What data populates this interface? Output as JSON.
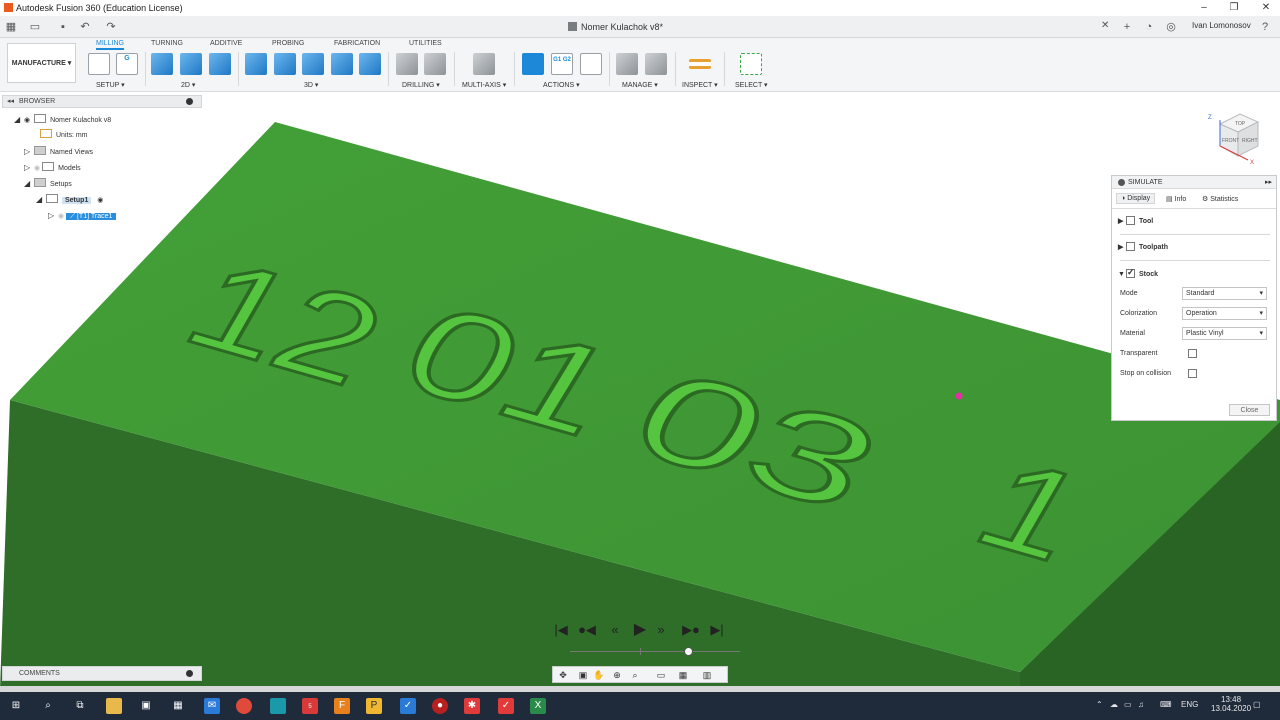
{
  "window": {
    "title": "Autodesk Fusion 360 (Education License)"
  },
  "tabbar": {
    "doc_title": "Nomer Kulachok v8*",
    "user": "Ivan Lomonosov"
  },
  "ribbon": {
    "workspace": "MANUFACTURE",
    "tabs": [
      "MILLING",
      "TURNING",
      "ADDITIVE",
      "PROBING",
      "FABRICATION",
      "UTILITIES"
    ],
    "groups": [
      "SETUP",
      "2D",
      "3D",
      "DRILLING",
      "MULTI-AXIS",
      "ACTIONS",
      "MANAGE",
      "INSPECT",
      "SELECT"
    ],
    "actions_icon_text": "G1 G2"
  },
  "browser": {
    "header": "BROWSER",
    "root": "Nomer Kulachok v8",
    "units": "Units: mm",
    "named_views": "Named Views",
    "models": "Models",
    "setups": "Setups",
    "setup1": "Setup1",
    "operation": "[T1] Trace1"
  },
  "comments": {
    "label": "COMMENTS"
  },
  "viewcube": {
    "top": "TOP",
    "front": "FRONT",
    "right": "RIGHT",
    "z": "Z",
    "x": "X"
  },
  "model": {
    "engraving": [
      "12",
      "01",
      "03",
      "1"
    ]
  },
  "simulate": {
    "title": "SIMULATE",
    "tabs": [
      "Display",
      "Info",
      "Statistics"
    ],
    "sections": {
      "tool": "Tool",
      "toolpath": "Toolpath",
      "stock": "Stock"
    },
    "mode_label": "Mode",
    "mode_value": "Standard",
    "colorization_label": "Colorization",
    "colorization_value": "Operation",
    "material_label": "Material",
    "material_value": "Plastic Vinyl",
    "transparent_label": "Transparent",
    "stop_label": "Stop on collision",
    "close_label": "Close"
  },
  "taskbar": {
    "lang": "ENG",
    "time": "13:48",
    "date": "13.04.2020",
    "badge": "5"
  },
  "colors": {
    "stock_top": "#3f9a34",
    "stock_front": "#2f6e29",
    "engrave": "#55c43f",
    "accent": "#1a8ad8"
  }
}
